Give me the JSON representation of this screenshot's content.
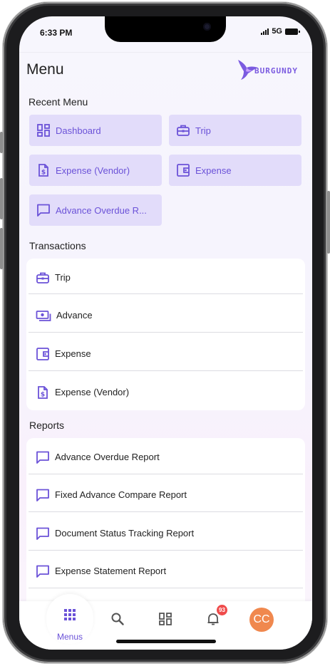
{
  "status_bar": {
    "time": "6:33 PM",
    "network": "5G"
  },
  "header": {
    "title": "Menu",
    "logo_text": "BURGUNDY"
  },
  "recent_menu": {
    "title": "Recent Menu",
    "items": [
      {
        "label": "Dashboard",
        "icon": "dashboard-icon"
      },
      {
        "label": "Trip",
        "icon": "briefcase-icon"
      },
      {
        "label": "Expense (Vendor)",
        "icon": "dollar-doc-icon"
      },
      {
        "label": "Expense",
        "icon": "wallet-icon"
      },
      {
        "label": "Advance Overdue R...",
        "icon": "chat-icon"
      }
    ]
  },
  "transactions": {
    "title": "Transactions",
    "items": [
      {
        "label": "Trip",
        "icon": "briefcase-icon"
      },
      {
        "label": "Advance",
        "icon": "cash-icon"
      },
      {
        "label": "Expense",
        "icon": "wallet-icon"
      },
      {
        "label": "Expense (Vendor)",
        "icon": "dollar-doc-icon"
      }
    ]
  },
  "reports": {
    "title": "Reports",
    "items": [
      {
        "label": "Advance Overdue Report",
        "icon": "chat-icon"
      },
      {
        "label": "Fixed Advance Compare Report",
        "icon": "chat-icon"
      },
      {
        "label": "Document Status Tracking Report",
        "icon": "chat-icon"
      },
      {
        "label": "Expense Statement Report",
        "icon": "chat-icon"
      }
    ]
  },
  "bottom_nav": {
    "menus_label": "Menus",
    "notification_count": "93",
    "avatar_initials": "CC"
  },
  "colors": {
    "accent": "#6b52d8",
    "tile_bg": "#e2dcfa",
    "badge": "#ef4b4b",
    "avatar": "#f0884e"
  }
}
